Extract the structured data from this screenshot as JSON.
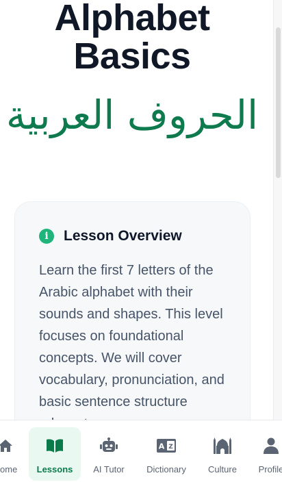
{
  "lesson": {
    "title_line1": "Alphabet",
    "title_line2": "Basics",
    "arabic_title": "الحروف العربية"
  },
  "overview": {
    "heading": "Lesson Overview",
    "body": "Learn the first 7 letters of the Arabic alphabet with their sounds and shapes. This level focuses on foundational concepts. We will cover vocabulary, pronunciation, and basic sentence structure relevant"
  },
  "nav": {
    "items": [
      {
        "label": "Home",
        "icon": "home-icon"
      },
      {
        "label": "Lessons",
        "icon": "book-icon",
        "active": true
      },
      {
        "label": "AI Tutor",
        "icon": "robot-icon"
      },
      {
        "label": "Dictionary",
        "icon": "dictionary-icon"
      },
      {
        "label": "Culture",
        "icon": "mosque-icon"
      },
      {
        "label": "Profile",
        "icon": "user-icon"
      }
    ]
  },
  "colors": {
    "accent_green": "#0e7a4e",
    "active_bg": "#e9f9f1",
    "title_dark": "#101828"
  }
}
